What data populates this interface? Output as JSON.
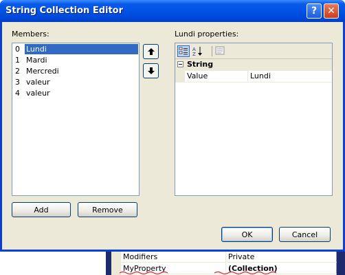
{
  "window": {
    "title": "String Collection Editor",
    "help_glyph": "?",
    "close_glyph": "✕"
  },
  "members": {
    "label": "Members:",
    "items": [
      {
        "index": "0",
        "name": "Lundi",
        "selected": true
      },
      {
        "index": "1",
        "name": "Mardi",
        "selected": false
      },
      {
        "index": "2",
        "name": "Mercredi",
        "selected": false
      },
      {
        "index": "3",
        "name": "valeur",
        "selected": false
      },
      {
        "index": "4",
        "name": "valeur",
        "selected": false
      }
    ],
    "move_up_icon": "arrow-up-icon",
    "move_down_icon": "arrow-down-icon"
  },
  "buttons": {
    "add": "Add",
    "remove": "Remove",
    "ok": "OK",
    "cancel": "Cancel"
  },
  "properties": {
    "label": "Lundi properties:",
    "toolbar_icons": [
      "categorized-icon",
      "alphabetical-icon",
      "property-pages-icon"
    ],
    "category": "String",
    "rows": [
      {
        "name": "Value",
        "value": "Lundi"
      }
    ]
  },
  "background_grid": {
    "rows": [
      {
        "name": "Modifiers",
        "value": "Private"
      },
      {
        "name": "MyProperty",
        "value": "(Collection)"
      }
    ]
  },
  "colors": {
    "title_bar": "#0053e6",
    "selection": "#316ac5",
    "dialog_face": "#ece9d8",
    "underline_annotation": "#e02020"
  }
}
